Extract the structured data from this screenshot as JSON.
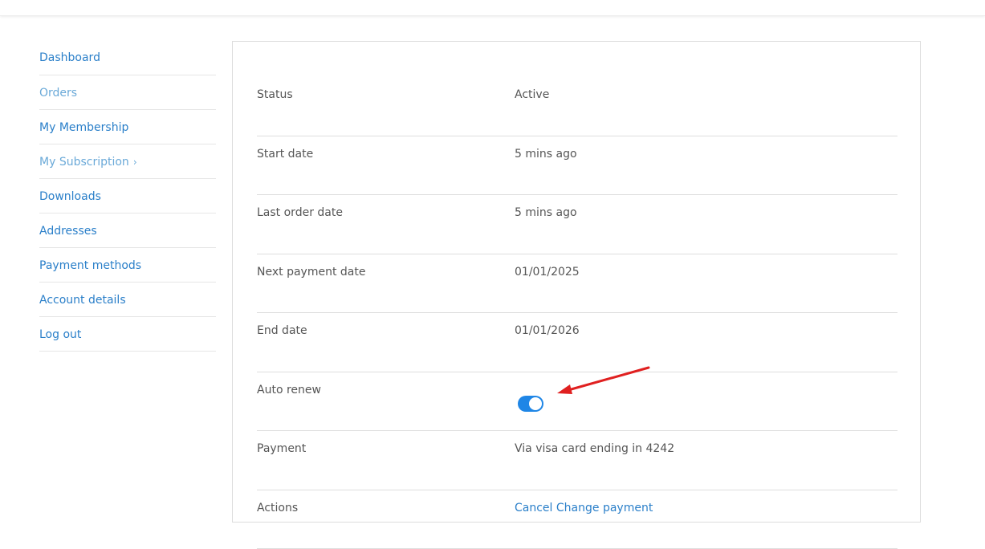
{
  "nav": {
    "items": [
      {
        "label": "Dashboard",
        "style": "normal"
      },
      {
        "label": "Orders",
        "style": "muted"
      },
      {
        "label": "My Membership",
        "style": "normal"
      },
      {
        "label": "My Subscription",
        "style": "muted",
        "chevron": "chevron-right-icon"
      },
      {
        "label": "Downloads",
        "style": "normal"
      },
      {
        "label": "Addresses",
        "style": "normal"
      },
      {
        "label": "Payment methods",
        "style": "normal"
      },
      {
        "label": "Account details",
        "style": "normal"
      },
      {
        "label": "Log out",
        "style": "normal"
      }
    ]
  },
  "subscription": {
    "status": {
      "label": "Status",
      "value": "Active"
    },
    "start_date": {
      "label": "Start date",
      "value": "5 mins ago"
    },
    "last_order_date": {
      "label": "Last order date",
      "value": "5 mins ago"
    },
    "next_payment_date": {
      "label": "Next payment date",
      "value": "01/01/2025"
    },
    "end_date": {
      "label": "End date",
      "value": "01/01/2026"
    },
    "auto_renew": {
      "label": "Auto renew",
      "enabled": true
    },
    "payment": {
      "label": "Payment",
      "value": "Via visa card ending in 4242"
    },
    "actions": {
      "label": "Actions",
      "cancel": "Cancel",
      "change_payment": "Change payment"
    }
  },
  "annotation": {
    "icon": "red-arrow-icon",
    "color": "#e02020"
  },
  "colors": {
    "link": "#2a7fc9",
    "link_muted": "#6aa9d8",
    "toggle_on": "#1f86e6"
  }
}
